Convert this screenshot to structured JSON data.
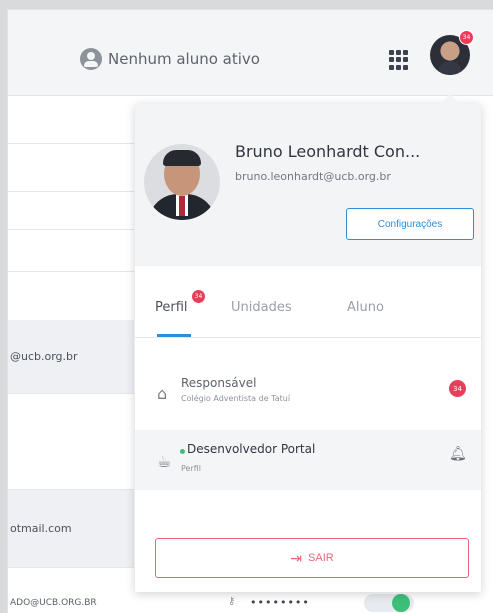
{
  "topbar": {
    "student_status": "Nenhum aluno ativo",
    "avatar_badge": "34"
  },
  "background_table": {
    "email_1": "@ucb.org.br",
    "email_2": "otmail.com",
    "footer_email": "ADO@UCB.ORG.BR",
    "footer_password": "••••••••"
  },
  "profile_panel": {
    "name": "Bruno Leonhardt Con...",
    "email": "bruno.leonhardt@ucb.org.br",
    "settings_label": "Configurações",
    "tabs": [
      {
        "label": "Perfil",
        "badge": "34"
      },
      {
        "label": "Unidades"
      },
      {
        "label": "Aluno"
      }
    ],
    "roles": [
      {
        "title": "Responsável",
        "subtitle": "Colégio Adventista de Tatuí",
        "badge": "34"
      },
      {
        "title": "Desenvolvedor Portal",
        "subtitle": "Perfil"
      }
    ],
    "logout_label": "SAIR"
  },
  "colors": {
    "accent": "#2f8ed6",
    "badge": "#e83e5a",
    "logout": "#e8667a",
    "active_dot": "#3dbf7a"
  }
}
